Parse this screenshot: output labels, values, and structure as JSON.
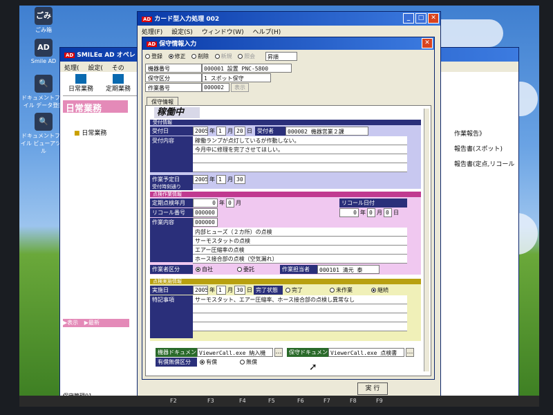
{
  "desktop": {
    "icons": [
      {
        "glyph": "ごみ",
        "label": "ごみ箱"
      },
      {
        "glyph": "AD",
        "label": "Smile AD"
      },
      {
        "glyph": "🔍",
        "label": "ドキュメントファイル データ登録"
      },
      {
        "glyph": "🔍",
        "label": "ドキュメントファイル ビューアツール"
      }
    ]
  },
  "bg_window": {
    "title": "SMILEα AD オペレ",
    "menu": [
      "処理(",
      "設定(",
      "その"
    ],
    "toolbar": [
      "日常業務",
      "定期業務"
    ],
    "banner": "日常業務",
    "folder_label": "日常業務",
    "right_links": [
      "作業報告》",
      "報告書(スポット)",
      "報告書(定点,リコール"
    ],
    "bottom_buttons": [
      "表示",
      "最新"
    ],
    "status": "保守管理01"
  },
  "main_window": {
    "title": "カード型入力処理 002",
    "menu": [
      "処理(F)",
      "設定(S)",
      "ウィンドウ(W)",
      "ヘルプ(H)"
    ],
    "fkeys": [
      "F2",
      "F3",
      "F4",
      "F5",
      "F6",
      "F7",
      "F8",
      "F9"
    ]
  },
  "dialog": {
    "title": "保守情報入力",
    "modes": [
      "登録",
      "修正",
      "削除",
      "新規",
      "照会"
    ],
    "selected_mode": "修正",
    "mode_value": "昇順",
    "header_rows": [
      {
        "label": "機器番号",
        "value": "000001 設置 PNC-5800"
      },
      {
        "label": "保守区分",
        "value": "1 スポット保守"
      },
      {
        "label": "作業番号",
        "value": "000002",
        "button": "表示"
      }
    ],
    "tab": "保守情報",
    "status_stamp": "稼働中",
    "reception": {
      "section": "受付情報",
      "date_label": "受付日",
      "date": {
        "y": "2005",
        "m": "1",
        "d": "20",
        "unit_y": "年",
        "unit_m": "月",
        "unit_d": "日"
      },
      "receiver_label": "受付者",
      "receiver": "000002 機器営業２課",
      "content_label": "受付内容",
      "content_lines": [
        "稼働ランプが点灯しているが作動しない。",
        "今月中に修理を完了させてほしい。",
        "",
        "",
        ""
      ],
      "planned_label": "作業予定日",
      "planned": {
        "y": "2005",
        "m": "1",
        "d": "30"
      },
      "time_label": "受付時刻通り"
    },
    "inspection": {
      "section": "点検作業情報",
      "periodic_label": "定期点検年月",
      "periodic": {
        "y": "0",
        "m": "0"
      },
      "recall_date_label": "リコール日付",
      "recall_date": {
        "y": "0",
        "m": "0",
        "d": "0"
      },
      "recall_no_label": "リコール番号",
      "recall_no": "000000",
      "work_label": "作業内容",
      "work_code": "000000",
      "work_lines": [
        "内部ヒューズ（２カ所）の点検",
        "サーモスタットの点検",
        "エアー圧縮率の点検",
        "ホース接合部の点検（空気漏れ）"
      ],
      "worker_type_label": "作業者区分",
      "worker_types": [
        "自社",
        "委託"
      ],
      "worker_label": "作業担当者",
      "worker": "000101 清元 泰"
    },
    "result": {
      "section": "点検実施情報",
      "date_label": "実施日",
      "date": {
        "y": "2005",
        "m": "1",
        "d": "30"
      },
      "status_label": "完了状態",
      "statuses": [
        "完了",
        "未作業",
        "継続"
      ],
      "selected_status": "継続",
      "notes_label": "特記事項",
      "notes_lines": [
        "サーモスタット、エアー圧縮率、ホース接合部の点検し異常なし",
        "",
        "",
        "",
        ""
      ]
    },
    "docs": {
      "machine_doc_label": "機器ドキュメント",
      "machine_doc": "ViewerCall.exe 納入機",
      "maint_doc_label": "保守ドキュメント",
      "maint_doc": "ViewerCall.exe 点検書",
      "paid_label": "有償無償区分",
      "paid_options": [
        "有償",
        "無償"
      ]
    },
    "execute_button": "実 行"
  },
  "colors": {
    "titlebar": "#0a3aa8",
    "label_bg": "#2a2f7a",
    "reception": "#c8c8f0",
    "inspection": "#f0c8f0",
    "result": "#f0f0b8",
    "pink": "#e48ab8"
  }
}
